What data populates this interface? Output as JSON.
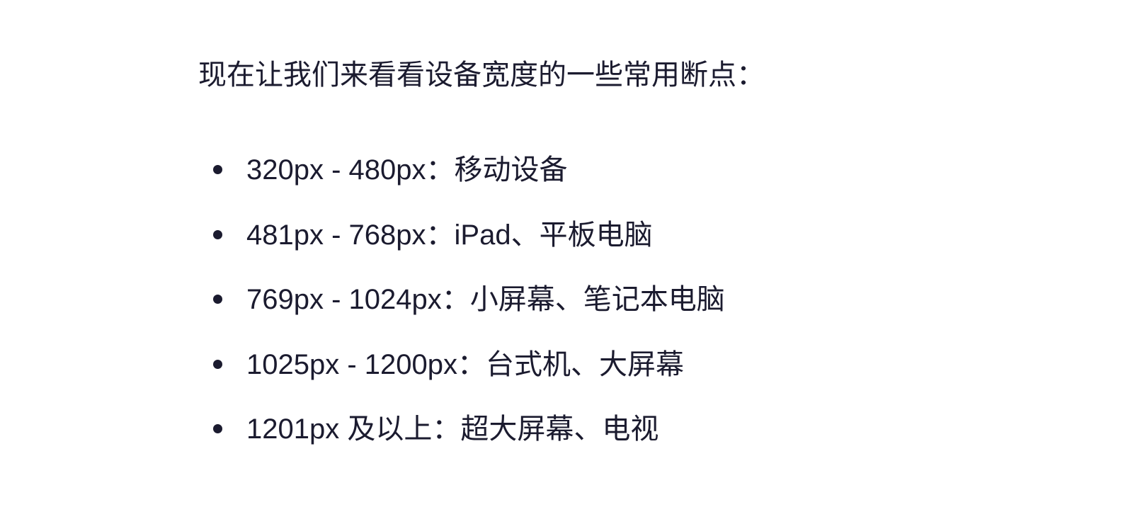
{
  "intro": "现在让我们来看看设备宽度的一些常用断点：",
  "breakpoints": [
    {
      "text": "320px - 480px：移动设备"
    },
    {
      "text": "481px - 768px：iPad、平板电脑"
    },
    {
      "text": "769px - 1024px：小屏幕、笔记本电脑"
    },
    {
      "text": "1025px - 1200px：台式机、大屏幕"
    },
    {
      "text": "1201px 及以上：超大屏幕、电视"
    }
  ]
}
